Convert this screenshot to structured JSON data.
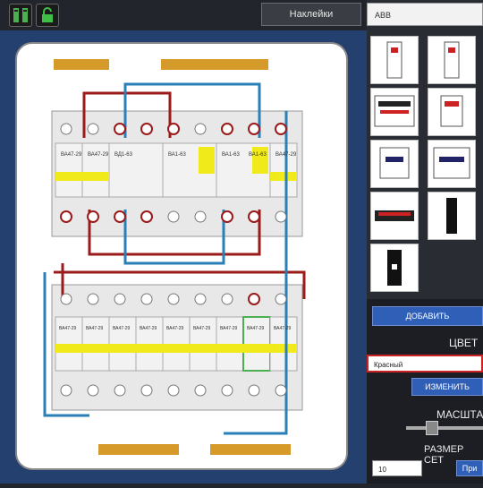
{
  "toolbar": {
    "stickers_label": "Наклейки"
  },
  "side": {
    "brand_value": "ABB",
    "add_label": "ДОБАВИТЬ",
    "color_title": "ЦВЕТ",
    "color_value": "Красный",
    "change_label": "ИЗМЕНИТЬ",
    "scale_title": "МАСШТАБ",
    "net_title": "РАЗМЕР СЕТ",
    "size_value": "10",
    "apply_label": "При"
  },
  "modules": {
    "top": [
      "ВА47-29",
      "ВА47-29",
      "ВД1-63",
      "ВА1-63",
      "ВА1-63",
      "ВА1-63",
      "ВА47-29"
    ],
    "bottom": [
      "ВА47-29",
      "ВА47-29",
      "ВА47-29",
      "ВА47-29",
      "ВА47-29",
      "ВА47-29",
      "ВА47-29",
      "ВА47-29",
      "ВА47-29"
    ]
  },
  "icons": [
    "sticker-sheet-icon",
    "unlock-icon"
  ]
}
